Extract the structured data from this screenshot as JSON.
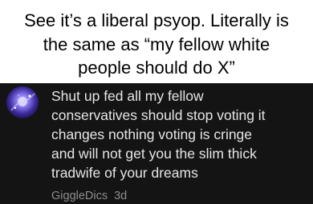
{
  "caption": {
    "lines": [
      "See it’s a liberal psyop. Literally is",
      "the same as “my fellow white",
      "people should do X”"
    ]
  },
  "comment": {
    "avatar_icon": "galaxy-avatar-icon",
    "lines": [
      "Shut up fed all my fellow",
      "conservatives should stop voting it",
      "changes nothing voting is cringe",
      "and will not get you the slim thick",
      "tradwife of your dreams"
    ],
    "username": "GiggleDics",
    "timestamp": "3d"
  },
  "colors": {
    "comment_background": "#141414",
    "comment_text": "#e6e6e6",
    "meta_text": "#8e8e8e"
  }
}
